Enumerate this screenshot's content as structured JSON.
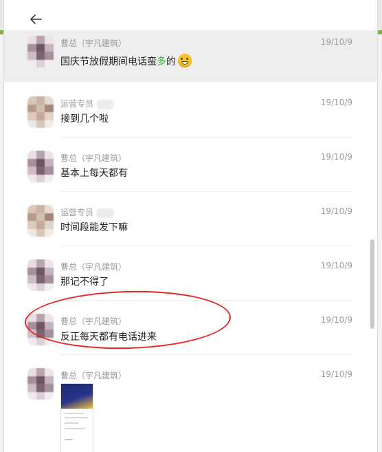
{
  "window": {
    "back_label": "←"
  },
  "messages": [
    {
      "sender": "曹总（宇凡建筑）",
      "time": "19/10/9",
      "text_before": "国庆节放假期间电话蛮",
      "text_green": "多",
      "text_after": "的",
      "emoji": "grinning-face-emoji",
      "highlighted": true
    },
    {
      "sender": "运营专员",
      "time": "19/10/9",
      "text": "接到几个啦"
    },
    {
      "sender": "曹总（宇凡建筑）",
      "time": "19/10/9",
      "text": "基本上每天都有"
    },
    {
      "sender": "运营专员",
      "time": "19/10/9",
      "text": "时间段能发下嘛"
    },
    {
      "sender": "曹总（宇凡建筑）",
      "time": "19/10/9",
      "text": "那记不得了"
    },
    {
      "sender": "曹总（宇凡建筑）",
      "time": "19/10/9",
      "text": "反正每天都有电话进来",
      "circled": true
    },
    {
      "sender": "曹总（宇凡建筑）",
      "time": "19/10/9",
      "attachment": "screenshot-image"
    }
  ],
  "colors": {
    "annotation_circle": "#e52424",
    "green_text": "#2db52d",
    "highlight_bg": "#eeeeee"
  }
}
